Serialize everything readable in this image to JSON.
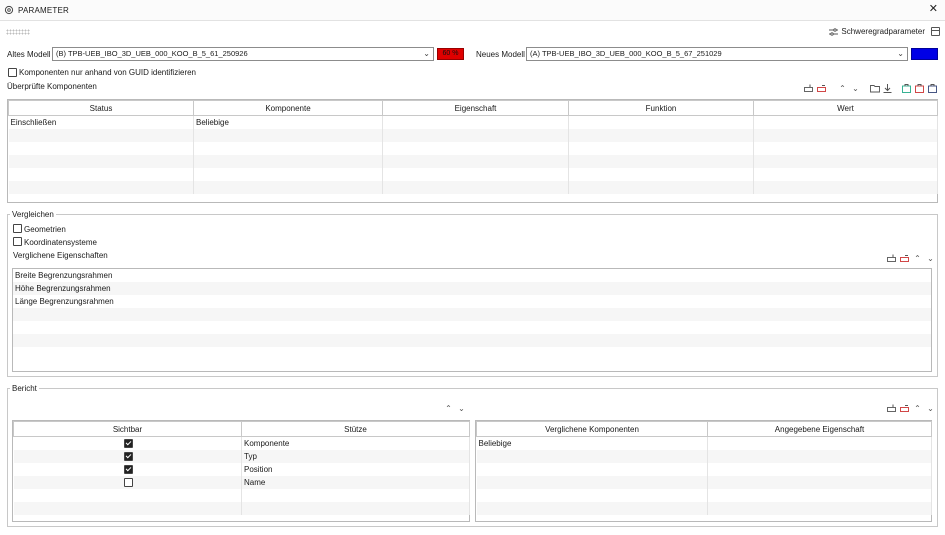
{
  "window": {
    "title": "PARAMETER",
    "close_icon": "close-icon",
    "settings_icon": "gear-icon"
  },
  "toolbar": {
    "severity_label": "Schweregradparameter"
  },
  "models": {
    "old_label": "Altes Modell",
    "old_value": "(B) TPB-UEB_IBO_3D_UEB_000_KOO_B_5_61_250926",
    "old_badge": "60 %",
    "old_badge_color": "#e00000",
    "new_label": "Neues Modell",
    "new_value": "(A) TPB-UEB_IBO_3D_UEB_000_KOO_B_5_67_251029",
    "new_color": "#0000e6"
  },
  "guid_checkbox": {
    "label": "Komponenten nur anhand von GUID identifizieren",
    "checked": false
  },
  "checked_components": {
    "title": "Überprüfte Komponenten",
    "columns": [
      "Status",
      "Komponente",
      "Eigenschaft",
      "Funktion",
      "Wert"
    ],
    "rows": [
      [
        "Einschließen",
        "Beliebige",
        "",
        "",
        ""
      ]
    ]
  },
  "compare": {
    "title": "Vergleichen",
    "geometry": {
      "label": "Geometrien",
      "checked": false
    },
    "coords": {
      "label": "Koordinatensysteme",
      "checked": false
    },
    "props_title": "Verglichene Eigenschaften",
    "props": [
      "Breite Begrenzungsrahmen",
      "Höhe Begrenzungsrahmen",
      "Länge Begrenzungsrahmen"
    ]
  },
  "report": {
    "title": "Bericht",
    "left_columns": [
      "Sichtbar",
      "Stütze"
    ],
    "left_rows": [
      {
        "visible": true,
        "label": "Komponente"
      },
      {
        "visible": true,
        "label": "Typ"
      },
      {
        "visible": true,
        "label": "Position"
      },
      {
        "visible": false,
        "label": "Name"
      }
    ],
    "right_columns": [
      "Verglichene Komponenten",
      "Angegebene Eigenschaft"
    ],
    "right_rows": [
      [
        "Beliebige",
        ""
      ]
    ]
  }
}
